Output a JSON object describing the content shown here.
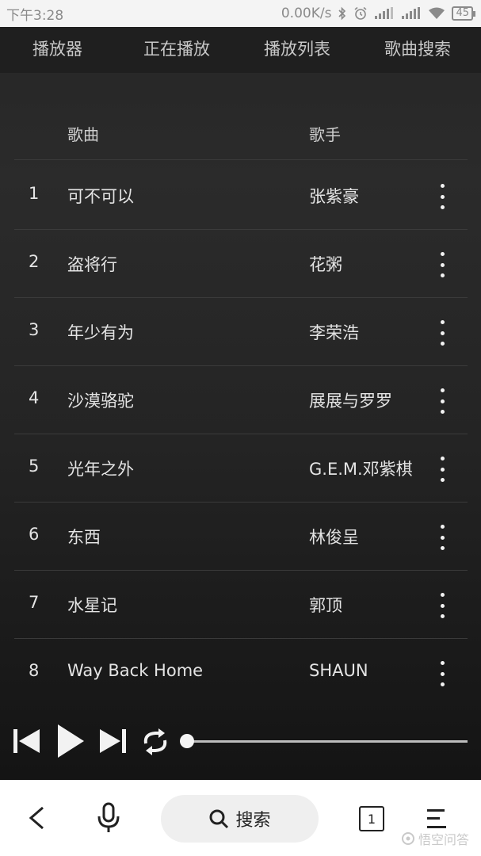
{
  "status_bar": {
    "time": "下午3:28",
    "net_speed": "0.00K/s",
    "battery": "45"
  },
  "nav_tabs": [
    {
      "label": "播放器"
    },
    {
      "label": "正在播放"
    },
    {
      "label": "播放列表"
    },
    {
      "label": "歌曲搜索"
    }
  ],
  "list_header": {
    "song": "歌曲",
    "artist": "歌手"
  },
  "songs": [
    {
      "num": "1",
      "title": "可不可以",
      "artist": "张紫豪"
    },
    {
      "num": "2",
      "title": "盗将行",
      "artist": "花粥"
    },
    {
      "num": "3",
      "title": "年少有为",
      "artist": "李荣浩"
    },
    {
      "num": "4",
      "title": "沙漠骆驼",
      "artist": "展展与罗罗"
    },
    {
      "num": "5",
      "title": "光年之外",
      "artist": "G.E.M.邓紫棋"
    },
    {
      "num": "6",
      "title": "东西",
      "artist": "林俊呈"
    },
    {
      "num": "7",
      "title": "水星记",
      "artist": "郭顶"
    },
    {
      "num": "8",
      "title": "Way Back Home",
      "artist": "SHAUN"
    }
  ],
  "player": {
    "progress": 0
  },
  "browser_bar": {
    "search_label": "搜索",
    "tab_count": "1",
    "watermark": "悟空问答"
  },
  "colors": {
    "background": "#2a2a2a",
    "text": "#e4e4e4",
    "browser_bar": "#ffffff"
  }
}
